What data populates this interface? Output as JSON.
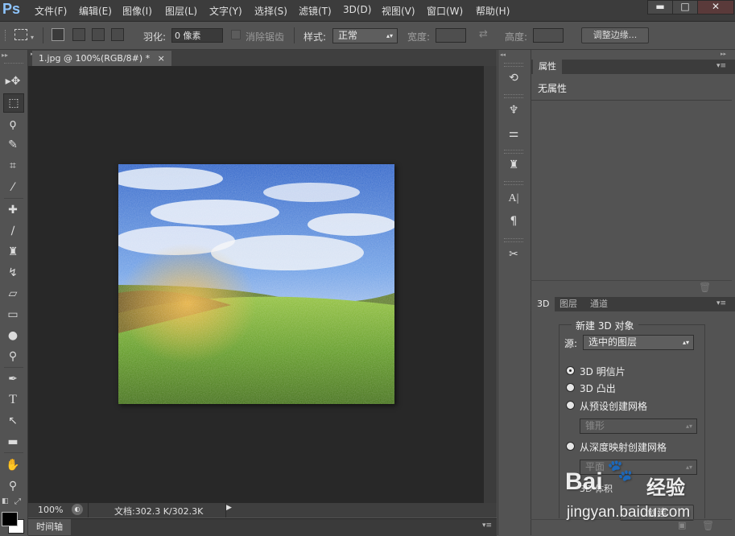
{
  "app": {
    "logo": "Ps"
  },
  "menu": [
    "文件(F)",
    "编辑(E)",
    "图像(I)",
    "图层(L)",
    "文字(Y)",
    "选择(S)",
    "滤镜(T)",
    "3D(D)",
    "视图(V)",
    "窗口(W)",
    "帮助(H)"
  ],
  "window_controls": {
    "minimize": "▬",
    "maximize": "□",
    "close": "✕"
  },
  "options": {
    "feather_label": "羽化:",
    "feather_value": "0 像素",
    "antialias_label": "消除锯齿",
    "style_label": "样式:",
    "style_value": "正常",
    "width_label": "宽度:",
    "height_label": "高度:",
    "refine_edge_button": "调整边缘..."
  },
  "document": {
    "tab_title": "1.jpg @ 100%(RGB/8#) *",
    "tab_close": "×",
    "zoom": "100%",
    "doc_info": "文档:302.3 K/302.3K",
    "timeline_label": "时间轴"
  },
  "properties_panel": {
    "tab": "属性",
    "content": "无属性"
  },
  "panel_3d": {
    "tabs": [
      "3D",
      "图层",
      "通道"
    ],
    "group_title": "新建 3D 对象",
    "source_label": "源:",
    "source_value": "选中的图层",
    "options": [
      {
        "label": "3D 明信片",
        "selected": true
      },
      {
        "label": "3D 凸出",
        "selected": false
      },
      {
        "label": "从预设创建网格",
        "selected": false
      },
      {
        "label": "从深度映射创建网格",
        "selected": false
      }
    ],
    "preset_value": "锥形",
    "depth_value": "平面",
    "create_button": "创建",
    "partial_label": "3D 体积"
  },
  "watermark": {
    "brand": "Bai",
    "brand_cn": "经验",
    "url": "jingyan.baidu.com"
  },
  "colors": {
    "accent": "#8ec5ff",
    "menubar": "#3c3c3c",
    "panel": "#535353",
    "canvas": "#282828"
  }
}
